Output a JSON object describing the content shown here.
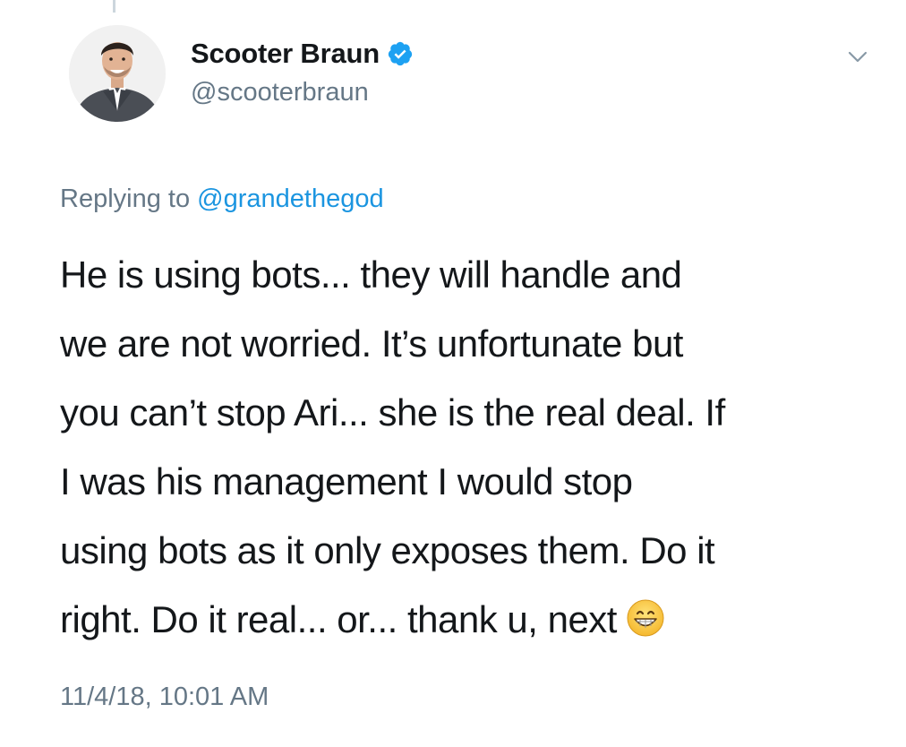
{
  "tweet": {
    "author": {
      "display_name": "Scooter Braun",
      "handle": "@scooterbraun",
      "verified": true
    },
    "reply_context": {
      "prefix": "Replying to",
      "mention": "@grandethegod"
    },
    "text_lines": [
      "He is using bots... they will handle and",
      "we are not worried. It’s unfortunate but",
      "you can’t stop Ari... she is the real deal. If",
      "I was his management I would stop",
      "using bots as it only exposes them. Do it",
      "right. Do it real... or... thank u, next"
    ],
    "timestamp": "11/4/18, 10:01 AM"
  },
  "icons": {
    "verified": "verified-badge-icon",
    "menu": "chevron-down-icon",
    "emoji": "grinning-face-emoji"
  },
  "colors": {
    "text": "#14171a",
    "secondary": "#657786",
    "accent": "#1b95e0",
    "verified": "#1da1f2"
  }
}
